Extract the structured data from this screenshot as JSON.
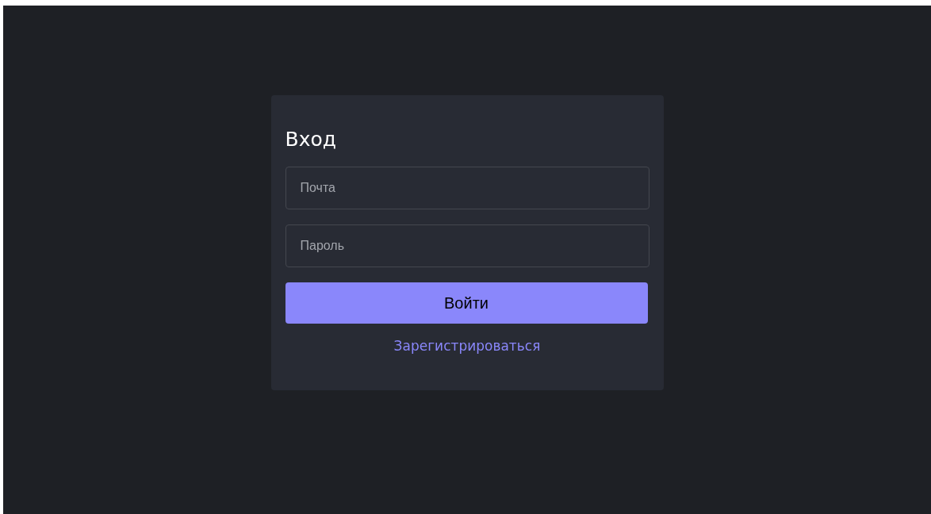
{
  "title": "Вход",
  "fields": [
    {
      "placeholder": "Почта"
    },
    {
      "placeholder": "Пароль"
    }
  ],
  "submit": "Войти",
  "register_link": "Зарегистрироваться"
}
